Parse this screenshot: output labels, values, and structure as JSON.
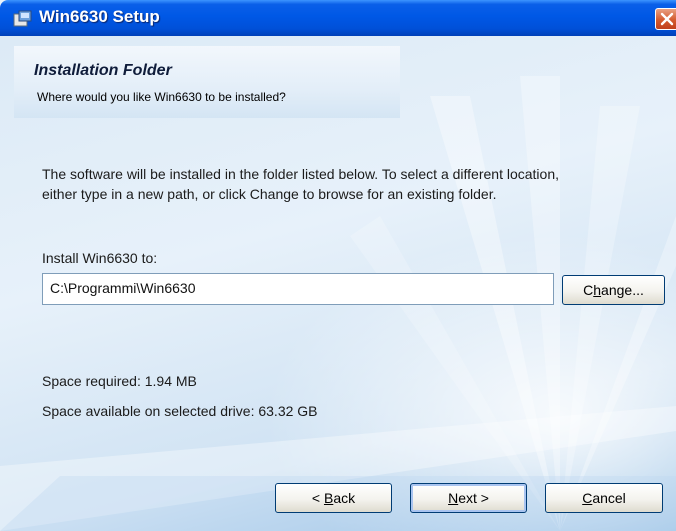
{
  "window": {
    "title": "Win6630 Setup"
  },
  "header": {
    "title": "Installation Folder",
    "subtitle": "Where would you like Win6630 to be installed?"
  },
  "body": {
    "description_line1": "The software will be installed in the folder listed below. To select a different location,",
    "description_line2": "either type in a new path, or click Change to browse for an existing folder.",
    "install_label": "Install Win6630 to:",
    "install_path": "C:\\Programmi\\Win6630",
    "space_required": "Space required: 1.94 MB",
    "space_available": "Space available on selected drive: 63.32 GB"
  },
  "buttons": {
    "change": {
      "pre": "C",
      "ul": "h",
      "post": "ange..."
    },
    "back": {
      "pre": "< ",
      "ul": "B",
      "post": "ack"
    },
    "next": {
      "pre": "",
      "ul": "N",
      "post": "ext >"
    },
    "cancel": {
      "pre": "",
      "ul": "C",
      "post": "ancel"
    }
  },
  "colors": {
    "titlebar": "#0058e6",
    "close_button": "#d45a2e",
    "button_border": "#003c74"
  },
  "icons": {
    "app": "setup-app-icon",
    "close": "close-icon"
  }
}
